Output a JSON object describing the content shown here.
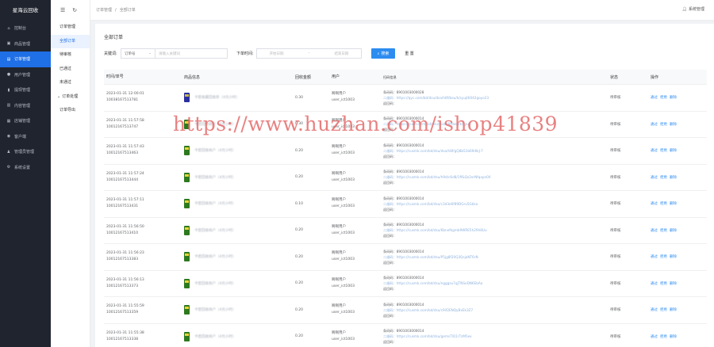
{
  "app": {
    "title": "星海云回收"
  },
  "sidebar": {
    "items": [
      {
        "label": "控制台",
        "icon": "home-icon"
      },
      {
        "label": "商品管理",
        "icon": "box-icon"
      },
      {
        "label": "订单管理",
        "icon": "order-icon",
        "active": true
      },
      {
        "label": "用户管理",
        "icon": "user-icon"
      },
      {
        "label": "提现管理",
        "icon": "chart-icon"
      },
      {
        "label": "内容管理",
        "icon": "document-icon"
      },
      {
        "label": "店铺管理",
        "icon": "store-icon"
      },
      {
        "label": "客户端",
        "icon": "client-icon"
      },
      {
        "label": "管理员管理",
        "icon": "admin-icon"
      },
      {
        "label": "系统设置",
        "icon": "gear-icon"
      }
    ]
  },
  "subnav": {
    "items": [
      {
        "label": "订单管理"
      },
      {
        "label": "全部订单",
        "active": true
      },
      {
        "label": "待审核"
      },
      {
        "label": "已通过"
      },
      {
        "label": "未通过"
      },
      {
        "label": "订单处理",
        "open": true
      },
      {
        "label": "订单导出"
      }
    ]
  },
  "topbar": {
    "breadcrumb": [
      "订单管理",
      "全部订单"
    ],
    "user": "系统管理"
  },
  "page": {
    "title": "全部订单"
  },
  "filter": {
    "keyword_label": "关键词:",
    "keyword_type": "订单号",
    "keyword_placeholder": "请输入关键词",
    "time_label": "下单时间:",
    "start_placeholder": "开始日期",
    "range_sep": "-",
    "end_placeholder": "结束日期",
    "search_label": "搜索",
    "reset_label": "重 置"
  },
  "table": {
    "headers": [
      "时间/单号",
      "商品信息",
      "回收金额",
      "用户",
      "扫码信息",
      "状态",
      "操作"
    ],
    "actions": [
      "通过",
      "拒绝",
      "删除"
    ],
    "rows": [
      {
        "time": "2023-01-31 12:00:01",
        "order_no": "10038167513781",
        "product": "卡密收藏回收券（4元小时）",
        "amount": "0.30",
        "user_name": "啊啊用户",
        "user_id": "user_ict1003",
        "scan_type": "条码码：8901003000028",
        "scan_qr": "二维码：https://qyc.com/bd/dsu/dsa/h8f/beu/k/syujt6042goyo23",
        "scan_other": "返回码：",
        "status": "待审核",
        "thumb": "blue"
      },
      {
        "time": "2023-01-31 11:57:58",
        "order_no": "10012167513747",
        "product": "卡密回收商户（4元小时）",
        "amount": "0.30",
        "user_name": "啊啊用户",
        "user_id": "user_ict1003",
        "scan_type": "条码码：8901003000014",
        "scan_qr": "二维码：https://cusm.com/bd/dsu/dsa/h8f/beu/k/syuj",
        "scan_other": "返回码：",
        "status": "待审核",
        "thumb": "green"
      },
      {
        "time": "2023-01-31 11:57:43",
        "order_no": "10012167513463",
        "product": "卡密回收商户（4元小时）",
        "amount": "0.20",
        "user_name": "啊啊用户",
        "user_id": "user_ict1003",
        "scan_type": "条码码：8901003000014",
        "scan_qr": "二维码：https://cusmk.com/bd/dsu/dsa/h8f/gQ8b51b69dlkJ-7",
        "scan_other": "返回码：",
        "status": "待审核",
        "thumb": "green"
      },
      {
        "time": "2023-01-31 11:57:24",
        "order_no": "10012167513444",
        "product": "卡密回收商户（4元小时）",
        "amount": "0.20",
        "user_name": "啊啊用户",
        "user_id": "user_ict1003",
        "scan_type": "条码码：8901003000014",
        "scan_qr": "二维码：https://cusmk.com/bd/dsu/h9d/c6d8/1ff&Qz2erNfqxpn0X",
        "scan_other": "返回码：",
        "status": "待审核",
        "thumb": "green"
      },
      {
        "time": "2023-01-31 11:57:11",
        "order_no": "10012167513431",
        "product": "卡密回收商户（4元小时）",
        "amount": "0.10",
        "user_name": "啊啊用户",
        "user_id": "user_ict1003",
        "scan_type": "条码码：8901003000014",
        "scan_qr": "二维码：https://cusmk.com/bd/dsu/c3d3e6f89DGru5Gkka",
        "scan_other": "返回码：",
        "status": "待审核",
        "thumb": "green"
      },
      {
        "time": "2023-01-31 11:56:50",
        "order_no": "10012167513410",
        "product": "卡密回收商户（4元小时）",
        "amount": "0.20",
        "user_name": "啊啊用户",
        "user_id": "user_ict1003",
        "scan_type": "条码码：8901003000014",
        "scan_qr": "二维码：https://cusmk.com/bd/dsu/6bnefkgmb9WRE5h29h8Uu",
        "scan_other": "返回码：",
        "status": "待审核",
        "thumb": "green"
      },
      {
        "time": "2023-01-31 11:56:23",
        "order_no": "10012167513383",
        "product": "卡密回收商户（4元小时）",
        "amount": "0.20",
        "user_name": "啊啊用户",
        "user_id": "user_ict1003",
        "scan_type": "条码码：8901003000014",
        "scan_qr": "二维码：https://cusmk.com/bd/dsu/P5jg8f20Q3QsjaNT6rN",
        "scan_other": "返回码：",
        "status": "待审核",
        "thumb": "green"
      },
      {
        "time": "2023-01-31 11:56:13",
        "order_no": "10012167513373",
        "product": "卡密回收商户（4元小时）",
        "amount": "0.20",
        "user_name": "啊啊用户",
        "user_id": "user_ict1003",
        "scan_type": "条码码：8901003000014",
        "scan_qr": "二维码：https://cusmk.com/bd/dsu/ngggsu7qjTNSoDN6EbAa",
        "scan_other": "返回码：",
        "status": "待审核",
        "thumb": "green"
      },
      {
        "time": "2023-01-31 11:55:59",
        "order_no": "10012167513359",
        "product": "卡密回收商户（4元小时）",
        "amount": "0.20",
        "user_name": "啊啊用户",
        "user_id": "user_ict1003",
        "scan_type": "条码码：8901003000014",
        "scan_qr": "二维码：https://cusmk.com/bd/dsu/c9if2ENQyBxEk3Z7",
        "scan_other": "返回码：",
        "status": "待审核",
        "thumb": "green"
      },
      {
        "time": "2023-01-31 11:55:38",
        "order_no": "10012167513338",
        "product": "卡密回收商户（4元小时）",
        "amount": "0.20",
        "user_name": "啊啊用户",
        "user_id": "user_ict1003",
        "scan_type": "条码码：8901003000014",
        "scan_qr": "二维码：https://cusmk.com/bd/dsu/gemsTlQ1rTzM5ex",
        "scan_other": "返回码：",
        "status": "待审核",
        "thumb": "green"
      }
    ]
  },
  "watermark": "https://www.huzhan.com/ishop41839",
  "colors": {
    "sidebar_bg": "#20242f",
    "accent": "#1f6fe6",
    "link": "#2d8cf0",
    "watermark": "#e46c6c"
  }
}
